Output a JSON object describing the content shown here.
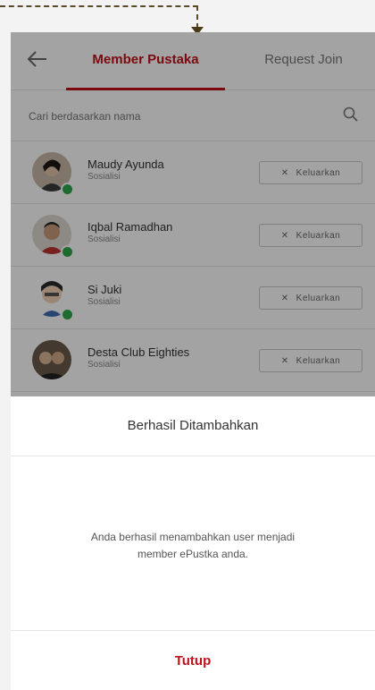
{
  "header": {
    "back_icon": "arrow-left-icon",
    "tabs": [
      {
        "label": "Member Pustaka",
        "active": true
      },
      {
        "label": "Request Join",
        "active": false
      }
    ]
  },
  "search": {
    "placeholder": "Cari berdasarkan nama",
    "icon": "search-icon"
  },
  "members": [
    {
      "name": "Maudy Ayunda",
      "role": "Sosialisi",
      "action": "Keluarkan",
      "online": true
    },
    {
      "name": "Iqbal Ramadhan",
      "role": "Sosialisi",
      "action": "Keluarkan",
      "online": true
    },
    {
      "name": "Si Juki",
      "role": "Sosialisi",
      "action": "Keluarkan",
      "online": true
    },
    {
      "name": "Desta Club Eighties",
      "role": "Sosialisi",
      "action": "Keluarkan",
      "online": false
    }
  ],
  "dialog": {
    "title": "Berhasil Ditambahkan",
    "message": "Anda berhasil menambahkan user menjadi member ePustka anda.",
    "button": "Tutup"
  },
  "colors": {
    "accent": "#c0101a",
    "online": "#2ea84a",
    "overlay": "rgba(0,0,0,0.36)"
  }
}
